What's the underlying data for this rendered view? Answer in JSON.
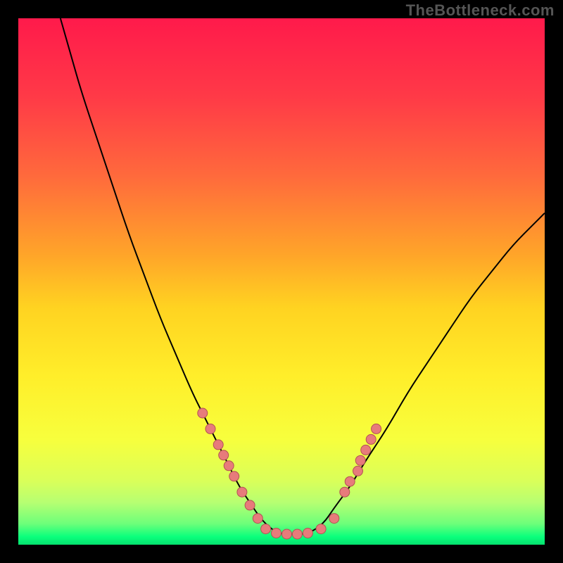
{
  "attribution": "TheBottleneck.com",
  "gradient": {
    "stops": [
      {
        "offset": 0.0,
        "color": "#ff1a4b"
      },
      {
        "offset": 0.15,
        "color": "#ff3a47"
      },
      {
        "offset": 0.3,
        "color": "#ff6a3c"
      },
      {
        "offset": 0.45,
        "color": "#ffa529"
      },
      {
        "offset": 0.55,
        "color": "#ffd321"
      },
      {
        "offset": 0.68,
        "color": "#ffee2a"
      },
      {
        "offset": 0.8,
        "color": "#f7ff3d"
      },
      {
        "offset": 0.88,
        "color": "#d9ff5a"
      },
      {
        "offset": 0.92,
        "color": "#b6ff72"
      },
      {
        "offset": 0.96,
        "color": "#6dff7a"
      },
      {
        "offset": 0.985,
        "color": "#0aff7c"
      },
      {
        "offset": 1.0,
        "color": "#05e06e"
      }
    ]
  },
  "markers": {
    "fill": "#e77b7b",
    "stroke": "#b25353",
    "radius": 7
  },
  "chart_data": {
    "type": "line",
    "title": "",
    "xlabel": "",
    "ylabel": "",
    "xlim": [
      0,
      100
    ],
    "ylim": [
      0,
      100
    ],
    "series": [
      {
        "name": "bottleneck-curve",
        "x": [
          8,
          10,
          12,
          15,
          18,
          21,
          24,
          27,
          30,
          33,
          35,
          38,
          40,
          42,
          44,
          46,
          48,
          50,
          52,
          55,
          58,
          60,
          63,
          66,
          70,
          74,
          78,
          82,
          86,
          90,
          94,
          98,
          100
        ],
        "y": [
          100,
          93,
          86,
          77,
          68,
          59,
          51,
          43,
          36,
          29,
          25,
          19,
          15,
          11,
          8,
          5,
          3,
          2,
          2,
          2,
          4,
          7,
          11,
          16,
          22,
          29,
          35,
          41,
          47,
          52,
          57,
          61,
          63
        ]
      },
      {
        "name": "left-cluster-points",
        "x": [
          35.0,
          36.5,
          38.0,
          39.0,
          40.0,
          41.0,
          42.5,
          44.0,
          45.5
        ],
        "y": [
          25.0,
          22.0,
          19.0,
          17.0,
          15.0,
          13.0,
          10.0,
          7.5,
          5.0
        ]
      },
      {
        "name": "bottom-cluster-points",
        "x": [
          47.0,
          49.0,
          51.0,
          53.0,
          55.0,
          57.5,
          60.0
        ],
        "y": [
          3.0,
          2.2,
          2.0,
          2.0,
          2.2,
          3.0,
          5.0
        ]
      },
      {
        "name": "right-cluster-points",
        "x": [
          62.0,
          63.0,
          64.5,
          65.0,
          66.0,
          67.0,
          68.0
        ],
        "y": [
          10.0,
          12.0,
          14.0,
          16.0,
          18.0,
          20.0,
          22.0
        ]
      }
    ],
    "grid": false,
    "legend": false
  }
}
